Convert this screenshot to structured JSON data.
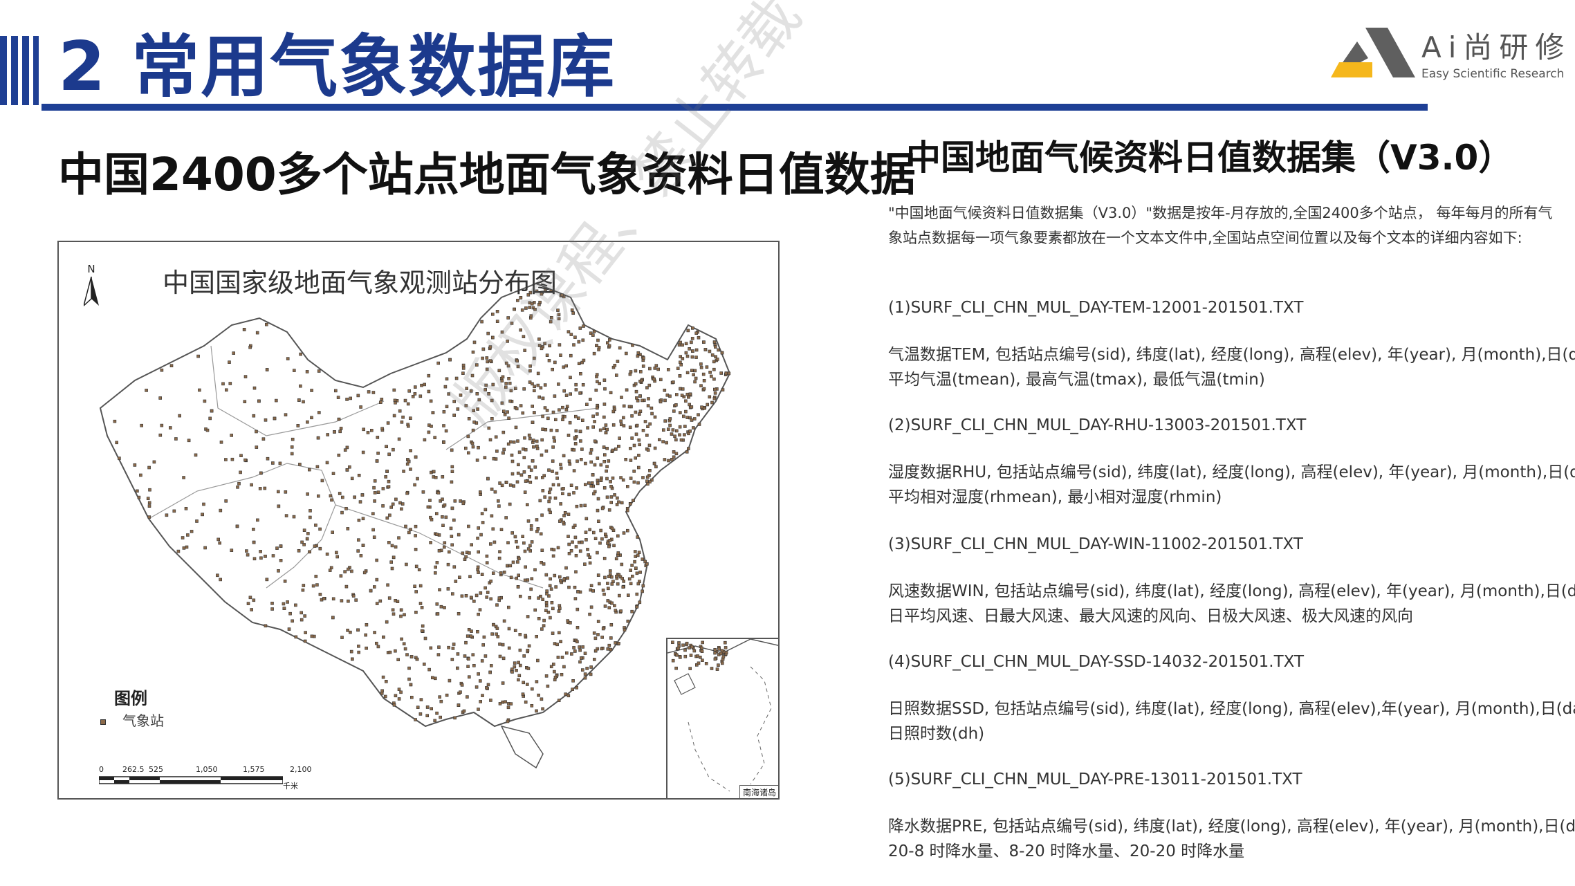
{
  "header": {
    "title": "2 常用气象数据库",
    "logo": {
      "name": "Ai尚研修",
      "tagline": "Easy Scientific Research"
    }
  },
  "left": {
    "title": "中国2400多个站点地面气象资料日值数据",
    "map": {
      "title": "中国国家级地面气象观测站分布图",
      "north_label": "N",
      "legend_title": "图例",
      "legend_item": "气象站",
      "scale_ticks": [
        "0",
        "262.5",
        "525",
        "1,050",
        "1,575",
        "2,100"
      ],
      "scale_unit": "千米",
      "inset_label": "南海诸岛"
    }
  },
  "right": {
    "title": "中国地面气候资料日值数据集（V3.0）",
    "intro": "\"中国地面气候资料日值数据集（V3.0）\"数据是按年-月存放的,全国2400多个站点， 每年每月的所有气象站点数据每一项气象要素都放在一个文本文件中,全国站点空间位置以及每个文本的详细内容如下:",
    "blocks": [
      {
        "file": "(1)SURF_CLI_CHN_MUL_DAY-TEM-12001-201501.TXT",
        "line1": "气温数据TEM, 包括站点编号(sid), 纬度(lat), 经度(long), 高程(elev), 年(year), 月(month),日(day),",
        "line2": "平均气温(tmean), 最高气温(tmax), 最低气温(tmin)"
      },
      {
        "file": "(2)SURF_CLI_CHN_MUL_DAY-RHU-13003-201501.TXT",
        "line1": "湿度数据RHU, 包括站点编号(sid), 纬度(lat), 经度(long), 高程(elev), 年(year), 月(month),日(day),",
        "line2": "平均相对湿度(rhmean), 最小相对湿度(rhmin)"
      },
      {
        "file": "(3)SURF_CLI_CHN_MUL_DAY-WIN-11002-201501.TXT",
        "line1": "风速数据WIN, 包括站点编号(sid), 纬度(lat), 经度(long), 高程(elev), 年(year), 月(month),日(day),",
        "line2": "日平均风速、日最大风速、最大风速的风向、日极大风速、极大风速的风向"
      },
      {
        "file": "(4)SURF_CLI_CHN_MUL_DAY-SSD-14032-201501.TXT",
        "line1": "日照数据SSD, 包括站点编号(sid), 纬度(lat), 经度(long), 高程(elev),年(year), 月(month),日(day),",
        "line2": "日照时数(dh)"
      },
      {
        "file": "(5)SURF_CLI_CHN_MUL_DAY-PRE-13011-201501.TXT",
        "line1": "降水数据PRE, 包括站点编号(sid), 纬度(lat), 经度(long), 高程(elev), 年(year), 月(month),日(day),",
        "line2": "20-8 时降水量、8-20 时降水量、20-20 时降水量"
      }
    ]
  },
  "watermark": "版权课程、禁止转载",
  "colors": {
    "brand_blue": "#1f3f93",
    "logo_yellow": "#f5b71c",
    "logo_gray": "#5f5f5f",
    "station_dot": "#8b6a4a"
  }
}
